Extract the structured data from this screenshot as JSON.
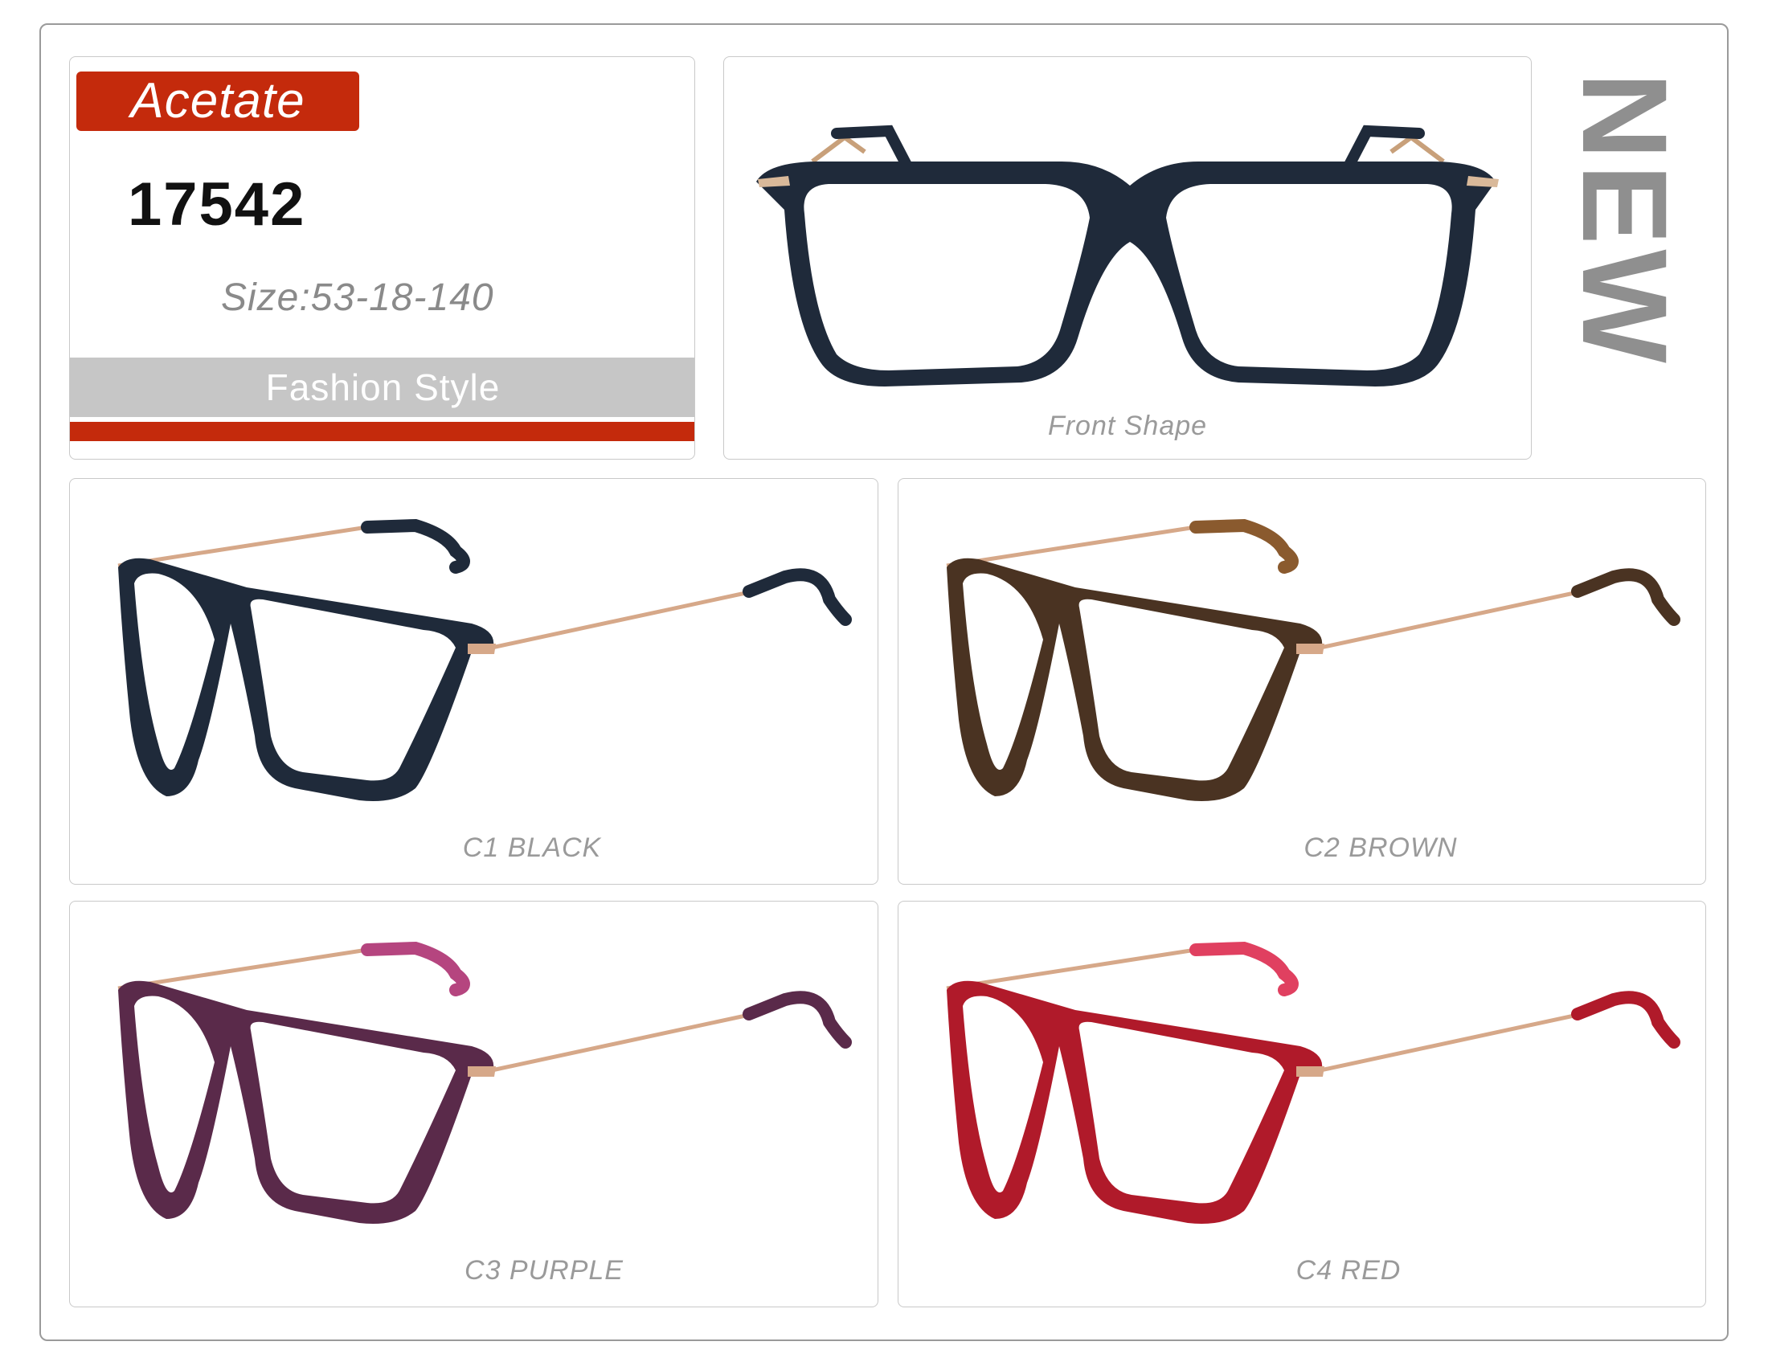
{
  "info": {
    "material": "Acetate",
    "model": "17542",
    "size": "Size:53-18-140",
    "style": "Fashion Style"
  },
  "badge": "NEW",
  "front": {
    "caption": "Front Shape",
    "frame_color": "#1f2a3a"
  },
  "colors": [
    {
      "caption": "C1 BLACK",
      "frame_color": "#1f2a3a",
      "accent": "#2d3a4d"
    },
    {
      "caption": "C2 BROWN",
      "frame_color": "#4a3322",
      "accent": "#8a5a2e"
    },
    {
      "caption": "C3 PURPLE",
      "frame_color": "#5a2a4a",
      "accent": "#b5457f"
    },
    {
      "caption": "C4 RED",
      "frame_color": "#b01a2a",
      "accent": "#e04060"
    }
  ]
}
